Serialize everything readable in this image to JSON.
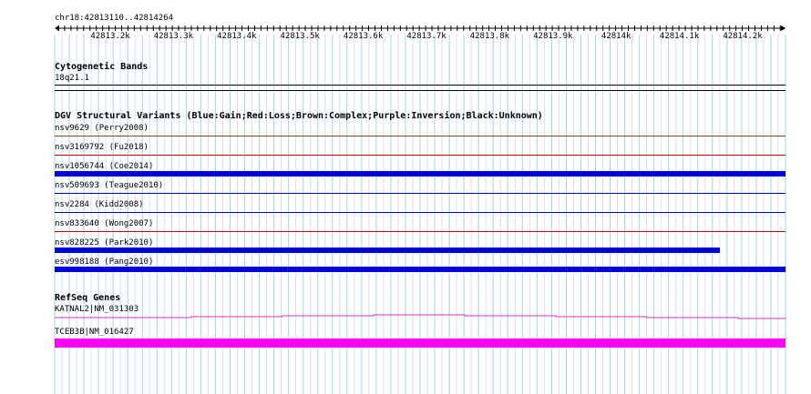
{
  "locus": "chr18:42813110..42814264",
  "ruler_ticks": [
    "42813.2k",
    "42813.3k",
    "42813.4k",
    "42813.5k",
    "42813.6k",
    "42813.7k",
    "42813.8k",
    "42813.9k",
    "42814k",
    "42814.1k",
    "42814.2k"
  ],
  "cytoband": {
    "title": "Cytogenetic Bands",
    "band": "18q21.1"
  },
  "dgv": {
    "title": "DGV Structural Variants (Blue:Gain;Red:Loss;Brown:Complex;Purple:Inversion;Black:Unknown)",
    "variants": [
      {
        "label": "nsv9629 (Perry2008)",
        "color": "#8b4513",
        "coverage": 1.0,
        "style": "line"
      },
      {
        "label": "nsv3169792 (Fu2018)",
        "color": "#cc0000",
        "coverage": 1.0,
        "style": "line"
      },
      {
        "label": "nsv1056744 (Coe2014)",
        "color": "#0000dd",
        "coverage": 1.0,
        "style": "bar"
      },
      {
        "label": "nsv509693 (Teague2010)",
        "color": "#0000aa",
        "coverage": 1.0,
        "style": "line"
      },
      {
        "label": "nsv2284 (Kidd2008)",
        "color": "#0000aa",
        "coverage": 1.0,
        "style": "line"
      },
      {
        "label": "nsv833640 (Wong2007)",
        "color": "#cc0000",
        "coverage": 1.0,
        "style": "line"
      },
      {
        "label": "nsv828225 (Park2010)",
        "color": "#0000dd",
        "coverage": 0.91,
        "style": "bar"
      },
      {
        "label": "esv998188 (Pang2010)",
        "color": "#0000dd",
        "coverage": 1.0,
        "style": "bar"
      }
    ]
  },
  "refseq": {
    "title": "RefSeq Genes",
    "genes": [
      {
        "label": "KATNAL2|NM_031303",
        "color": "#cc33cc"
      },
      {
        "label": "TCEB3B|NM_016427",
        "color": "#ff00ff"
      }
    ]
  }
}
